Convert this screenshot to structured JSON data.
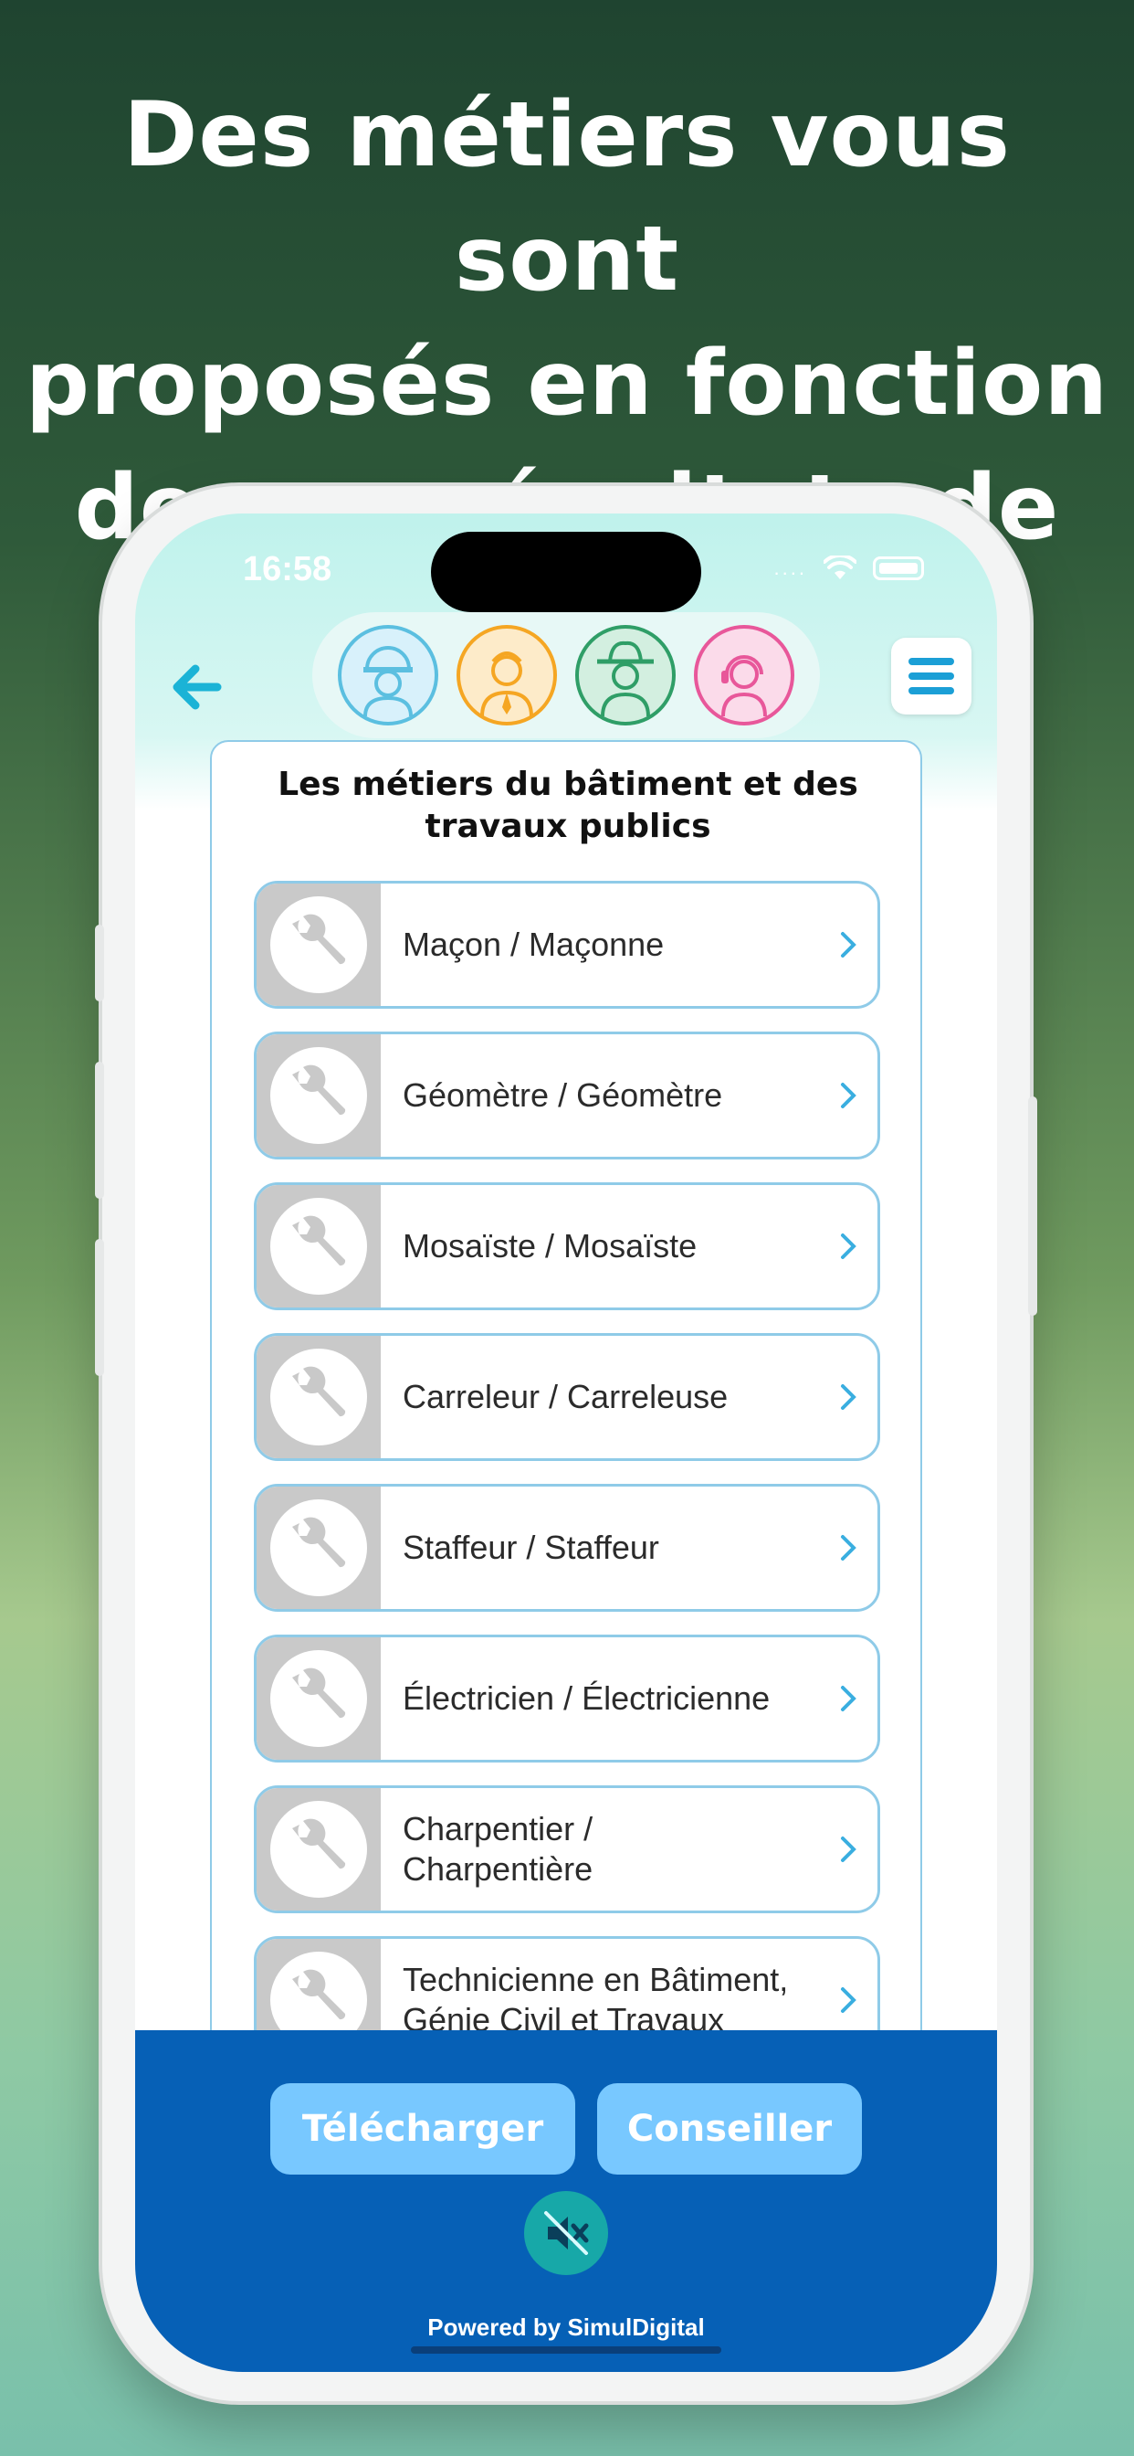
{
  "headline": {
    "line1": "Des métiers vous sont",
    "line2": "proposés en fonction",
    "line3": "de vos résultats de test"
  },
  "status_bar": {
    "time": "16:58",
    "signal": "...."
  },
  "header": {
    "back_icon": "arrow-left-icon",
    "menu_icon": "hamburger-menu-icon",
    "avatars": [
      {
        "name": "construction-worker-avatar",
        "color": "#5bbfe0"
      },
      {
        "name": "businessman-avatar",
        "color": "#f5a623"
      },
      {
        "name": "farmer-avatar",
        "color": "#2f9e67"
      },
      {
        "name": "operator-avatar",
        "color": "#e8579a"
      }
    ]
  },
  "card": {
    "title_line1": "Les métiers du bâtiment et des",
    "title_line2": "travaux publics",
    "jobs": [
      {
        "label": "Maçon / Maçonne"
      },
      {
        "label": "Géomètre / Géomètre"
      },
      {
        "label": "Mosaïste / Mosaïste"
      },
      {
        "label": "Carreleur / Carreleuse"
      },
      {
        "label": "Staffeur / Staffeur"
      },
      {
        "label": "Électricien / Électricienne"
      },
      {
        "label": "Charpentier / Charpentière"
      },
      {
        "label": "Technicienne en Bâtiment, Génie Civil et Travaux"
      }
    ]
  },
  "bottom": {
    "download_label": "Télécharger",
    "advisor_label": "Conseiller",
    "mute_icon": "speaker-muted-icon",
    "powered_by": "Powered by SimulDigital"
  },
  "colors": {
    "accent": "#1bb3d6",
    "panel": "#0660b6",
    "pill": "#78c8ff",
    "border": "#8fcbe8"
  }
}
